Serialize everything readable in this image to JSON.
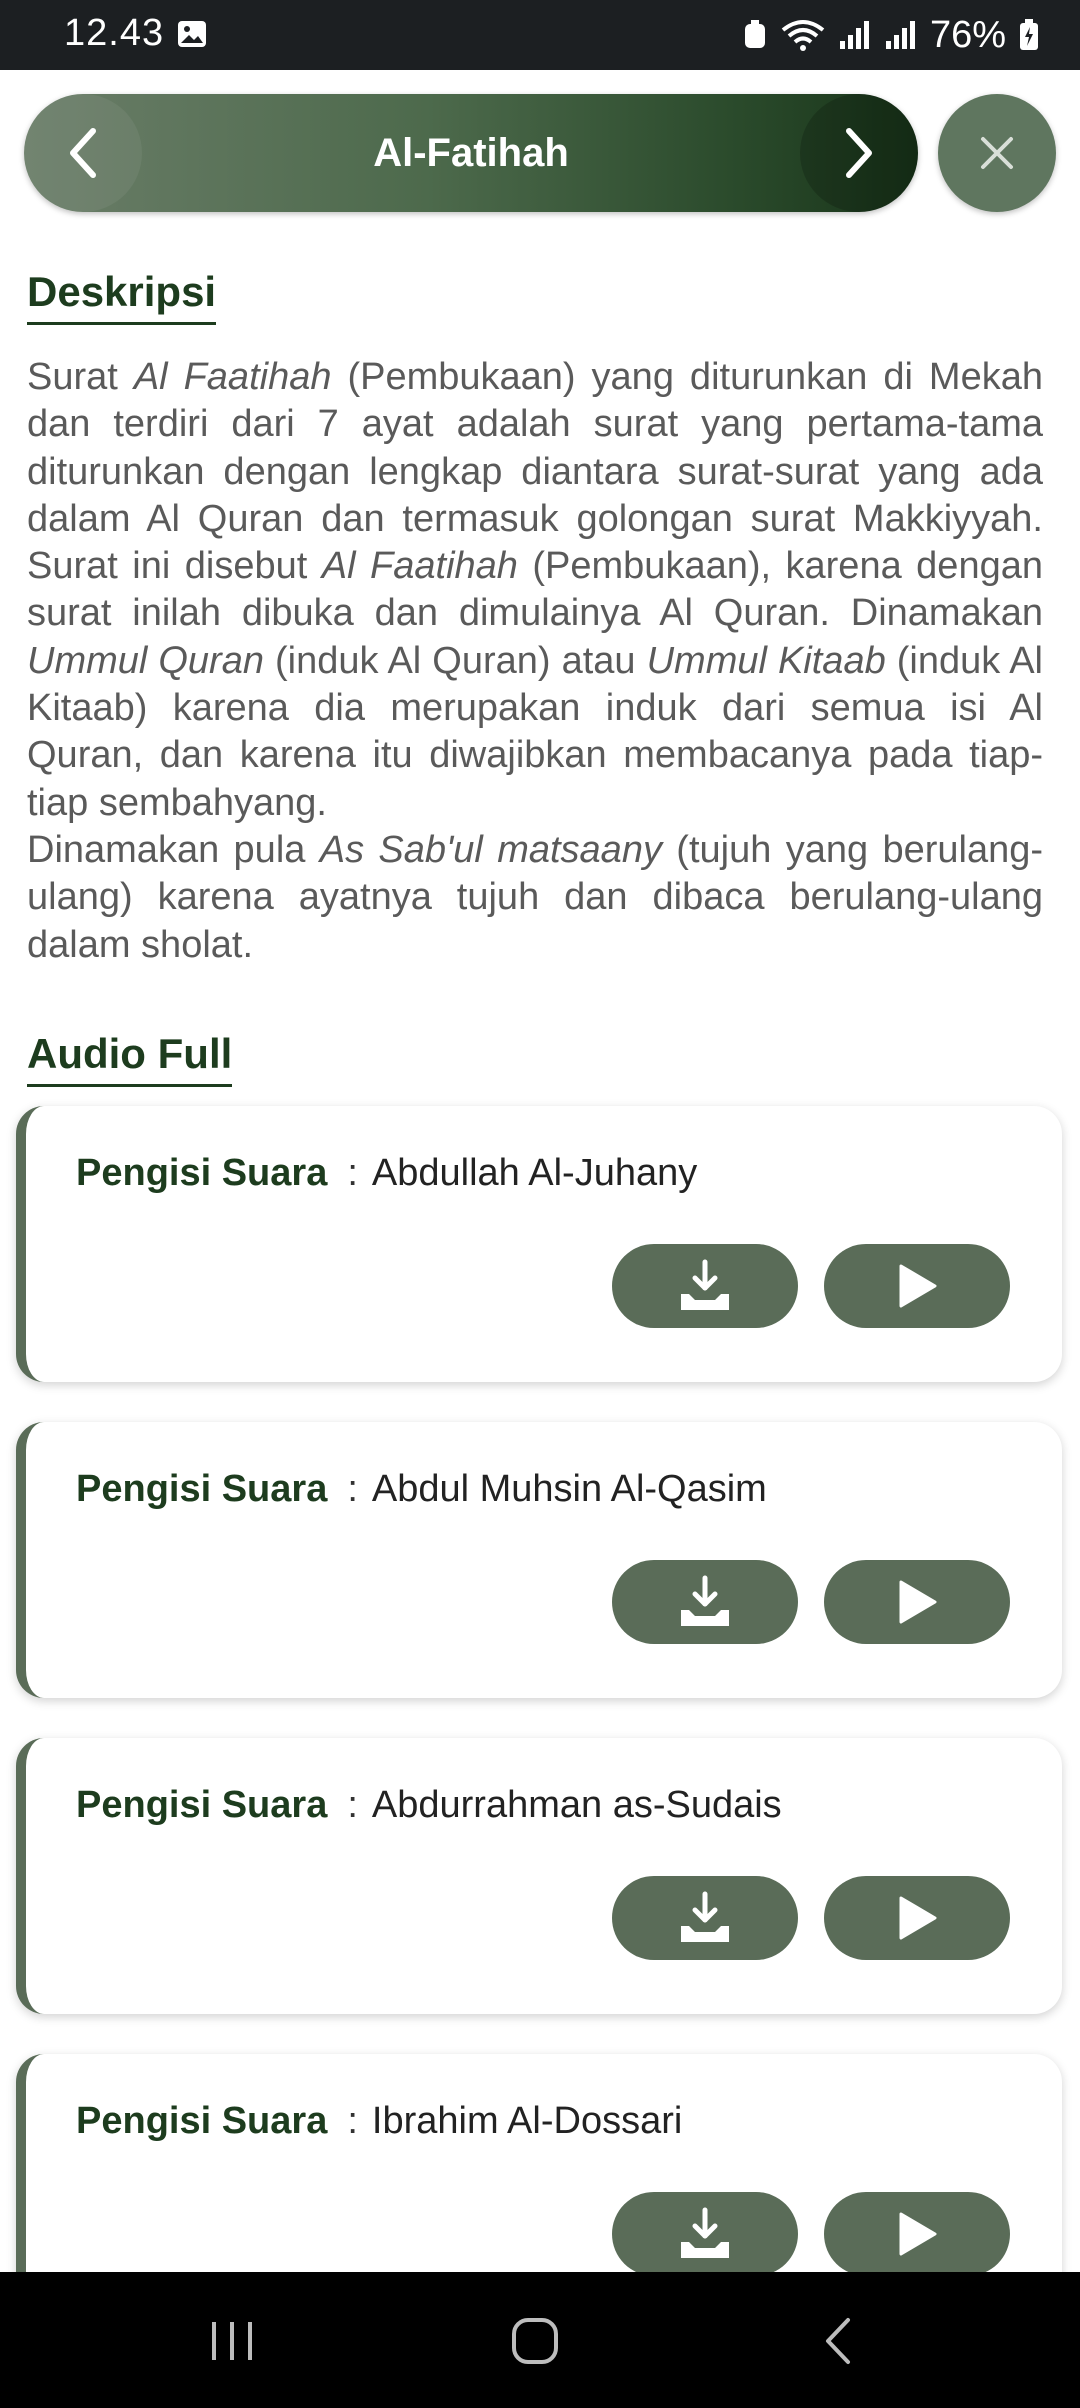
{
  "status_bar": {
    "time": "12.43",
    "battery": "76%"
  },
  "header": {
    "title": "Al-Fatihah"
  },
  "sections": {
    "description_title": "Deskripsi",
    "audio_title": "Audio Full"
  },
  "description": {
    "paragraph1": [
      {
        "t": "Surat ",
        "i": false
      },
      {
        "t": "Al Faatihah",
        "i": true
      },
      {
        "t": " (Pembukaan) yang diturunkan di Mekah dan terdiri dari 7 ayat adalah surat yang pertama-tama diturunkan dengan lengkap diantara surat-surat yang ada dalam Al Quran dan termasuk golongan surat Makkiyyah. Surat ini disebut ",
        "i": false
      },
      {
        "t": "Al Faatihah",
        "i": true
      },
      {
        "t": " (Pembukaan), karena dengan surat inilah dibuka dan dimulainya Al Quran. Dinamakan ",
        "i": false
      },
      {
        "t": "Ummul Quran",
        "i": true
      },
      {
        "t": " (induk Al Quran) atau ",
        "i": false
      },
      {
        "t": "Ummul Kitaab",
        "i": true
      },
      {
        "t": " (induk Al Kitaab) karena dia merupakan induk dari semua isi Al Quran, dan karena itu diwajibkan membacanya pada tiap-tiap sembahyang.",
        "i": false
      }
    ],
    "paragraph2": [
      {
        "t": "Dinamakan pula ",
        "i": false
      },
      {
        "t": "As Sab'ul matsaany",
        "i": true
      },
      {
        "t": " (tujuh yang berulang-ulang) karena ayatnya tujuh dan dibaca berulang-ulang dalam sholat.",
        "i": false
      }
    ]
  },
  "audio": {
    "label": "Pengisi Suara",
    "separator": ":",
    "reciters": [
      {
        "name": "Abdullah Al-Juhany"
      },
      {
        "name": "Abdul Muhsin Al-Qasim"
      },
      {
        "name": "Abdurrahman as-Sudais"
      },
      {
        "name": "Ibrahim Al-Dossari"
      }
    ]
  },
  "colors": {
    "primary": "#1d3c1e",
    "accent": "#5a6c58",
    "text": "#5a5a5a"
  },
  "icons": [
    "image-icon",
    "wifi-icon",
    "signal-icon",
    "battery-icon",
    "chevron-left-icon",
    "chevron-right-icon",
    "close-icon",
    "download-icon",
    "play-icon",
    "recents-icon",
    "home-icon",
    "back-icon"
  ]
}
